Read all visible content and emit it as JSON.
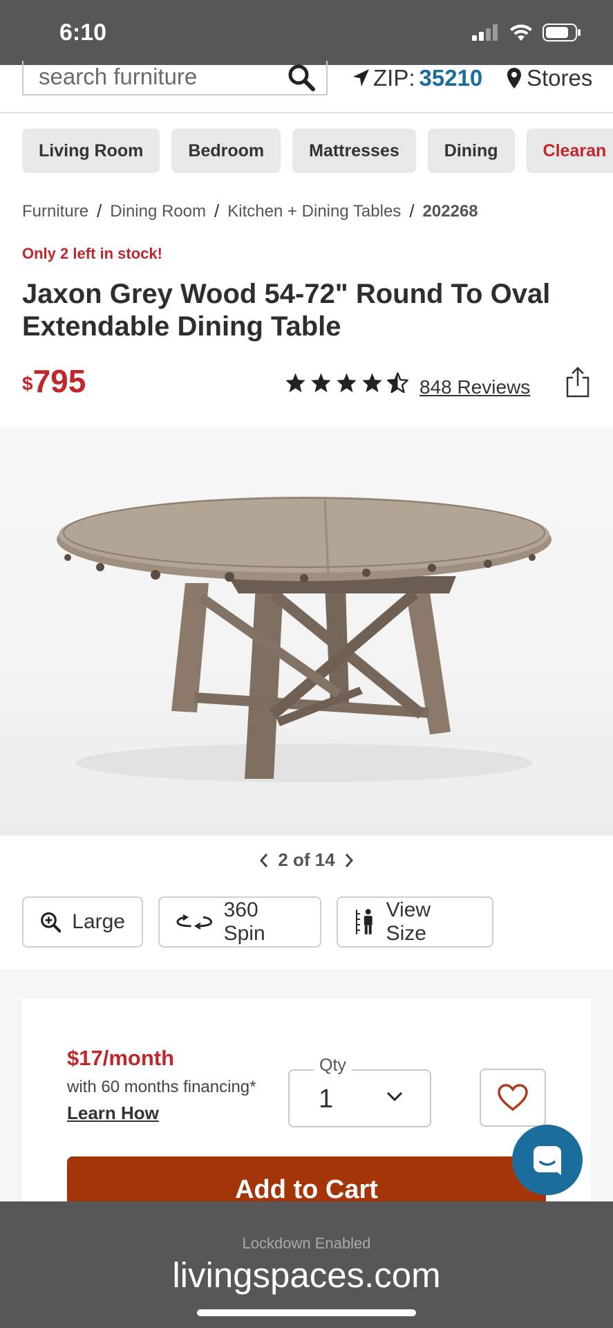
{
  "status_bar": {
    "time": "6:10"
  },
  "search": {
    "placeholder": "search furniture"
  },
  "location": {
    "zip_label": "ZIP:",
    "zip_value": "35210",
    "stores_label": "Stores"
  },
  "categories": [
    "Living Room",
    "Bedroom",
    "Mattresses",
    "Dining",
    "Clearan"
  ],
  "breadcrumb": [
    "Furniture",
    "Dining Room",
    "Kitchen + Dining Tables",
    "202268"
  ],
  "product": {
    "stock_note": "Only 2 left in stock!",
    "title": "Jaxon Grey Wood 54-72\" Round To Oval Extendable Dining Table",
    "currency": "$",
    "price": "795",
    "rating": 4.5,
    "reviews_label": "848 Reviews"
  },
  "gallery": {
    "pager": "2 of 14"
  },
  "tools": {
    "large": "Large",
    "spin": "360 Spin",
    "view_size": "View Size"
  },
  "purchase": {
    "monthly": "$17/month",
    "financing": "with 60 months financing*",
    "learn_how": "Learn How",
    "qty_label": "Qty",
    "qty_value": "1",
    "add_to_cart": "Add to Cart"
  },
  "browser": {
    "lockdown": "Lockdown Enabled",
    "url": "livingspaces.com"
  },
  "colors": {
    "accent_red": "#c0272d",
    "cart_button": "#a33508",
    "zip_blue": "#1b6d9b"
  }
}
